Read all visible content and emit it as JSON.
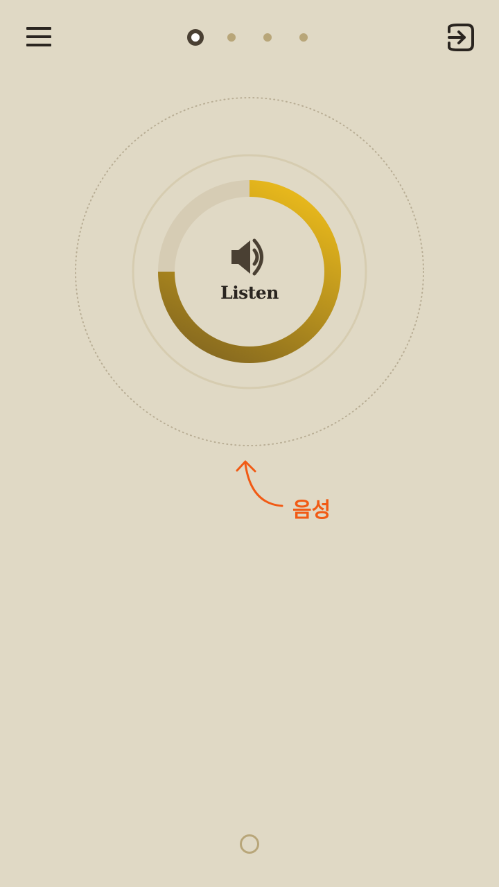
{
  "header": {
    "menu_icon": "hamburger-menu-icon",
    "login_icon": "sign-in-icon",
    "pager": {
      "total": 4,
      "active_index": 0
    }
  },
  "player": {
    "label": "Listen",
    "icon": "speaker-volume-icon",
    "progress": 0.75,
    "colors": {
      "ring_start": "#e6b71c",
      "ring_end": "#86691f",
      "ring_track": "#d6ccb4",
      "outline": "#d6ccb0",
      "dotted": "#b8ad94"
    }
  },
  "annotation": {
    "label": "음성",
    "color": "#f15a14"
  },
  "footer": {
    "home_icon": "home-circle-icon"
  },
  "theme": {
    "background": "#e0d9c5",
    "dark": "#2a2520"
  }
}
